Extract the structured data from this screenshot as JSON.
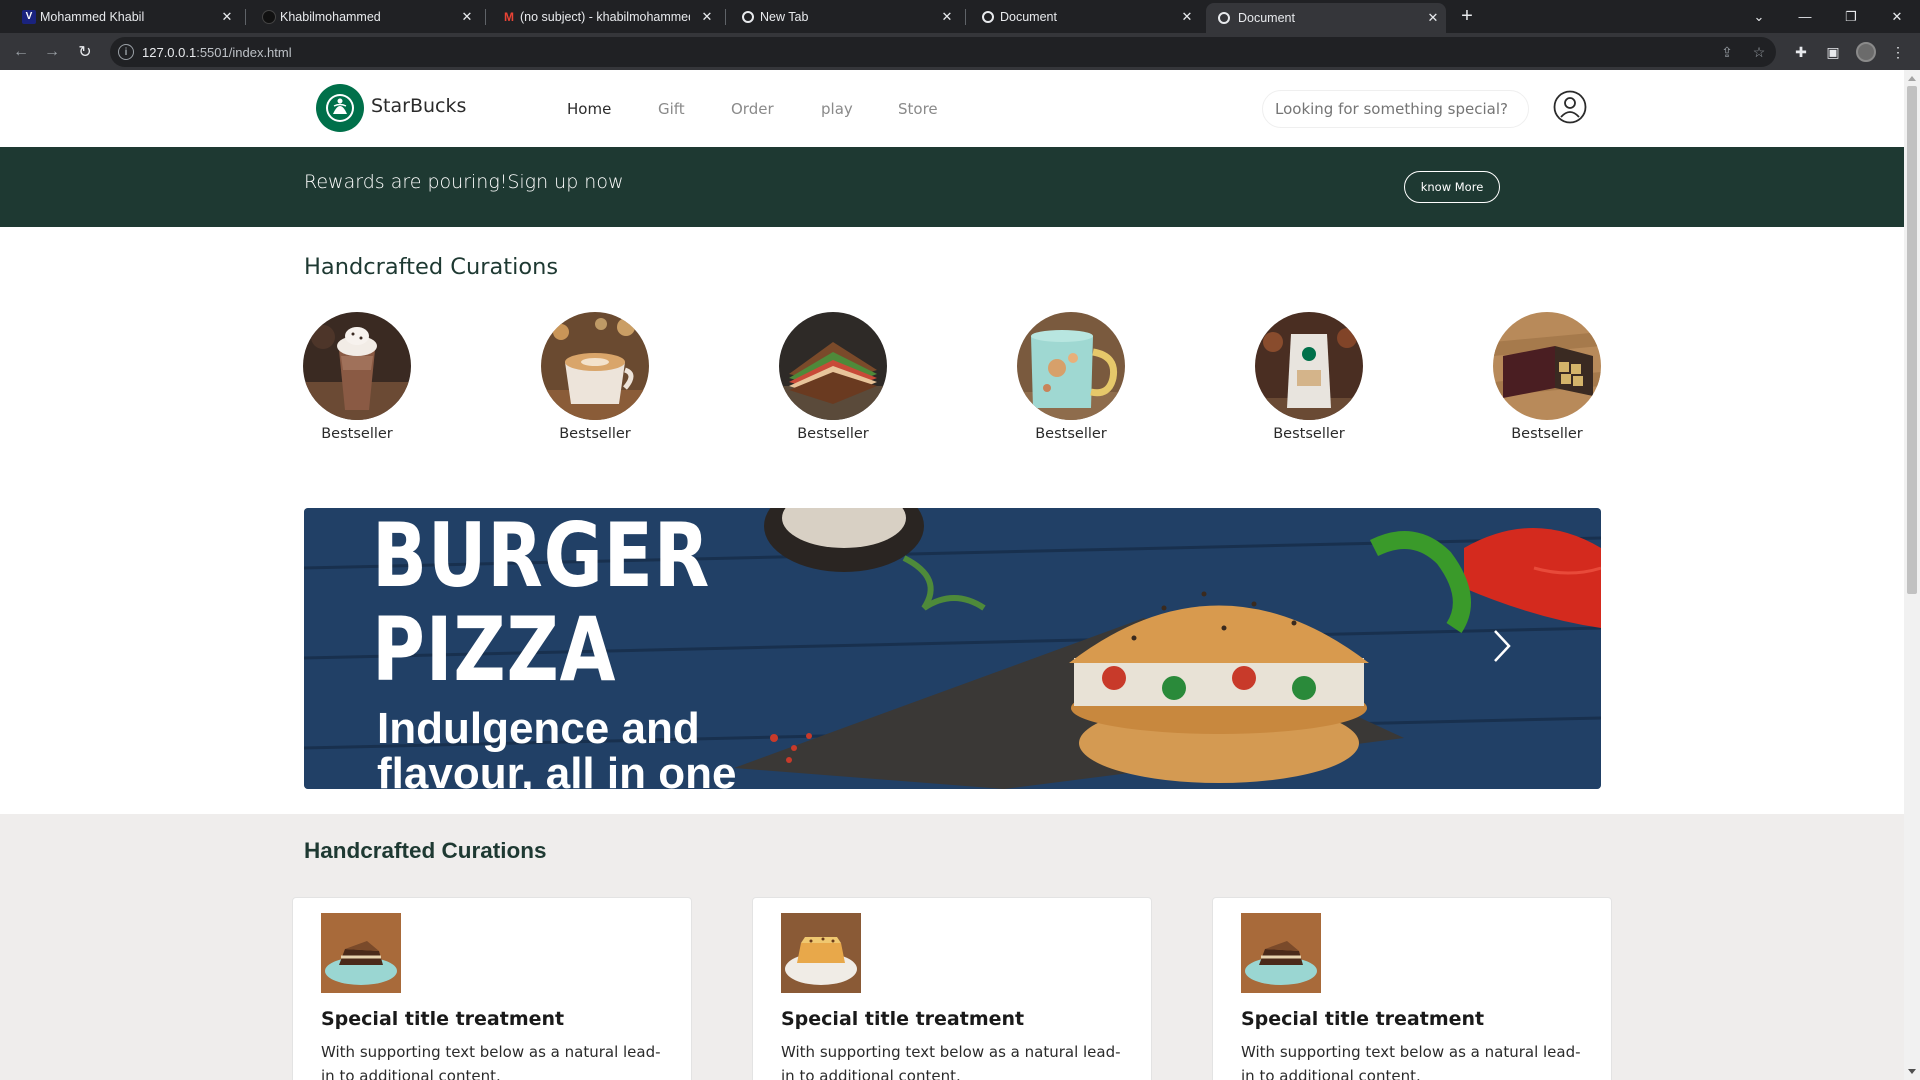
{
  "browser": {
    "tabs": [
      {
        "title": "Mohammed Khabil",
        "icon": "v-logo-icon"
      },
      {
        "title": "Khabilmohammed",
        "icon": "github-icon"
      },
      {
        "title": "(no subject) - khabilmohammed",
        "icon": "gmail-icon"
      },
      {
        "title": "New Tab",
        "icon": "chrome-icon"
      },
      {
        "title": "Document",
        "icon": "globe-icon"
      },
      {
        "title": "Document",
        "icon": "globe-icon"
      }
    ],
    "active_tab_index": 5,
    "url_host": "127.0.0.1",
    "url_rest": ":5501/index.html"
  },
  "header": {
    "brand": "StarBucks",
    "nav": [
      "Home",
      "Gift",
      "Order",
      "play",
      "Store"
    ],
    "active_nav": "Home",
    "search_placeholder": "Looking for something special?"
  },
  "rewards": {
    "text": "Rewards are pouring!Sign up now",
    "button": "know More"
  },
  "curations": {
    "title": "Handcrafted Curations",
    "items": [
      {
        "label": "Bestseller",
        "image": "frappuccino"
      },
      {
        "label": "Bestseller",
        "image": "latte"
      },
      {
        "label": "Bestseller",
        "image": "sandwich"
      },
      {
        "label": "Bestseller",
        "image": "mug"
      },
      {
        "label": "Bestseller",
        "image": "coffee-bag"
      },
      {
        "label": "Bestseller",
        "image": "chocolate-box"
      }
    ]
  },
  "promo": {
    "line1": "BURGER",
    "line2": "PIZZA",
    "line3": "Indulgence and",
    "line4": "flavour, all in one"
  },
  "lower": {
    "title": "Handcrafted Curations",
    "cards": [
      {
        "title": "Special title treatment",
        "text": "With supporting text below as a natural lead-in to additional content."
      },
      {
        "title": "Special title treatment",
        "text": "With supporting text below as a natural lead-in to additional content."
      },
      {
        "title": "Special title treatment",
        "text": "With supporting text below as a natural lead-in to additional content."
      }
    ]
  },
  "colors": {
    "brand_green": "#00704a",
    "banner_green": "#1e3932",
    "lower_bg": "#efedec"
  }
}
